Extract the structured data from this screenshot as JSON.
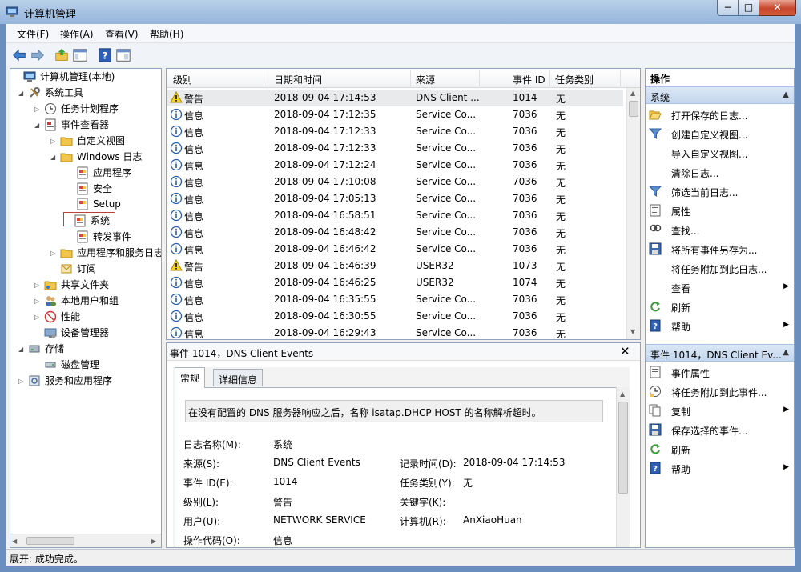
{
  "window": {
    "title": "计算机管理",
    "min": "−",
    "max": "□",
    "close": "✕"
  },
  "menu": [
    "文件(F)",
    "操作(A)",
    "查看(V)",
    "帮助(H)"
  ],
  "toolbar": [
    "back-arrow-icon",
    "forward-arrow-icon",
    "up-folder-icon",
    "show-hide-tree-icon",
    "help-icon",
    "properties-icon"
  ],
  "tree": [
    {
      "label": "计算机管理(本地)",
      "icon": "computer-icon",
      "expander": ""
    },
    {
      "label": "系统工具",
      "icon": "tools-icon",
      "expander": "◢"
    },
    {
      "label": "任务计划程序",
      "icon": "clock-icon",
      "expander": "▷"
    },
    {
      "label": "事件查看器",
      "icon": "event-viewer-icon",
      "expander": "◢"
    },
    {
      "label": "自定义视图",
      "icon": "folder-icon",
      "expander": "▷"
    },
    {
      "label": "Windows 日志",
      "icon": "folder-icon",
      "expander": "◢"
    },
    {
      "label": "应用程序",
      "icon": "log-icon",
      "expander": ""
    },
    {
      "label": "安全",
      "icon": "log-icon",
      "expander": ""
    },
    {
      "label": "Setup",
      "icon": "log-icon",
      "expander": ""
    },
    {
      "label": "系统",
      "icon": "log-icon",
      "expander": ""
    },
    {
      "label": "转发事件",
      "icon": "log-icon",
      "expander": ""
    },
    {
      "label": "应用程序和服务日志",
      "icon": "folder-icon",
      "expander": "▷"
    },
    {
      "label": "订阅",
      "icon": "subscription-icon",
      "expander": ""
    },
    {
      "label": "共享文件夹",
      "icon": "shared-folder-icon",
      "expander": "▷"
    },
    {
      "label": "本地用户和组",
      "icon": "users-icon",
      "expander": "▷"
    },
    {
      "label": "性能",
      "icon": "performance-icon",
      "expander": "▷"
    },
    {
      "label": "设备管理器",
      "icon": "device-manager-icon",
      "expander": ""
    },
    {
      "label": "存储",
      "icon": "storage-icon",
      "expander": "◢"
    },
    {
      "label": "磁盘管理",
      "icon": "disk-icon",
      "expander": ""
    },
    {
      "label": "服务和应用程序",
      "icon": "services-icon",
      "expander": "▷"
    }
  ],
  "events": {
    "columns": [
      "级别",
      "日期和时间",
      "来源",
      "事件 ID",
      "任务类别"
    ],
    "rows": [
      {
        "level": "警告",
        "type": "warning",
        "time": "2018-09-04 17:14:53",
        "source": "DNS Client ...",
        "id": "1014",
        "category": "无"
      },
      {
        "level": "信息",
        "type": "info",
        "time": "2018-09-04 17:12:35",
        "source": "Service Co...",
        "id": "7036",
        "category": "无"
      },
      {
        "level": "信息",
        "type": "info",
        "time": "2018-09-04 17:12:33",
        "source": "Service Co...",
        "id": "7036",
        "category": "无"
      },
      {
        "level": "信息",
        "type": "info",
        "time": "2018-09-04 17:12:33",
        "source": "Service Co...",
        "id": "7036",
        "category": "无"
      },
      {
        "level": "信息",
        "type": "info",
        "time": "2018-09-04 17:12:24",
        "source": "Service Co...",
        "id": "7036",
        "category": "无"
      },
      {
        "level": "信息",
        "type": "info",
        "time": "2018-09-04 17:10:08",
        "source": "Service Co...",
        "id": "7036",
        "category": "无"
      },
      {
        "level": "信息",
        "type": "info",
        "time": "2018-09-04 17:05:13",
        "source": "Service Co...",
        "id": "7036",
        "category": "无"
      },
      {
        "level": "信息",
        "type": "info",
        "time": "2018-09-04 16:58:51",
        "source": "Service Co...",
        "id": "7036",
        "category": "无"
      },
      {
        "level": "信息",
        "type": "info",
        "time": "2018-09-04 16:48:42",
        "source": "Service Co...",
        "id": "7036",
        "category": "无"
      },
      {
        "level": "信息",
        "type": "info",
        "time": "2018-09-04 16:46:42",
        "source": "Service Co...",
        "id": "7036",
        "category": "无"
      },
      {
        "level": "警告",
        "type": "warning",
        "time": "2018-09-04 16:46:39",
        "source": "USER32",
        "id": "1073",
        "category": "无"
      },
      {
        "level": "信息",
        "type": "info",
        "time": "2018-09-04 16:46:25",
        "source": "USER32",
        "id": "1074",
        "category": "无"
      },
      {
        "level": "信息",
        "type": "info",
        "time": "2018-09-04 16:35:55",
        "source": "Service Co...",
        "id": "7036",
        "category": "无"
      },
      {
        "level": "信息",
        "type": "info",
        "time": "2018-09-04 16:30:55",
        "source": "Service Co...",
        "id": "7036",
        "category": "无"
      },
      {
        "level": "信息",
        "type": "info",
        "time": "2018-09-04 16:29:43",
        "source": "Service Co...",
        "id": "7036",
        "category": "无"
      }
    ]
  },
  "detail": {
    "title": "事件 1014，DNS Client Events",
    "close": "✕",
    "tabs": [
      "常规",
      "详细信息"
    ],
    "description": "在没有配置的 DNS 服务器响应之后，名称 isatap.DHCP HOST 的名称解析超时。",
    "fields": {
      "log_name_label": "日志名称(M):",
      "log_name": "系统",
      "source_label": "来源(S):",
      "source": "DNS Client Events",
      "logged_label": "记录时间(D):",
      "logged": "2018-09-04 17:14:53",
      "event_id_label": "事件 ID(E):",
      "event_id": "1014",
      "task_label": "任务类别(Y):",
      "task": "无",
      "level_label": "级别(L):",
      "level": "警告",
      "keywords_label": "关键字(K):",
      "keywords": "",
      "user_label": "用户(U):",
      "user": "NETWORK SERVICE",
      "computer_label": "计算机(R):",
      "computer": "AnXiaoHuan",
      "opcode_label": "操作代码(O):",
      "opcode": "信息"
    }
  },
  "actions": {
    "header": "操作",
    "section1": "系统",
    "section1_items": [
      {
        "label": "打开保存的日志...",
        "icon": "open-folder-icon",
        "sub": ""
      },
      {
        "label": "创建自定义视图...",
        "icon": "filter-icon",
        "sub": ""
      },
      {
        "label": "导入自定义视图...",
        "icon": "",
        "sub": ""
      },
      {
        "label": "清除日志...",
        "icon": "",
        "sub": ""
      },
      {
        "label": "筛选当前日志...",
        "icon": "filter-icon",
        "sub": ""
      },
      {
        "label": "属性",
        "icon": "properties-icon",
        "sub": ""
      },
      {
        "label": "查找...",
        "icon": "find-icon",
        "sub": ""
      },
      {
        "label": "将所有事件另存为...",
        "icon": "save-icon",
        "sub": ""
      },
      {
        "label": "将任务附加到此日志...",
        "icon": "",
        "sub": ""
      },
      {
        "label": "查看",
        "icon": "",
        "sub": "▶"
      },
      {
        "label": "刷新",
        "icon": "refresh-icon",
        "sub": ""
      },
      {
        "label": "帮助",
        "icon": "help-icon",
        "sub": "▶"
      }
    ],
    "section2": "事件 1014，DNS Client Ev...",
    "section2_items": [
      {
        "label": "事件属性",
        "icon": "properties-icon",
        "sub": ""
      },
      {
        "label": "将任务附加到此事件...",
        "icon": "task-icon",
        "sub": ""
      },
      {
        "label": "复制",
        "icon": "copy-icon",
        "sub": "▶"
      },
      {
        "label": "保存选择的事件...",
        "icon": "save-icon",
        "sub": ""
      },
      {
        "label": "刷新",
        "icon": "refresh-icon",
        "sub": ""
      },
      {
        "label": "帮助",
        "icon": "help-icon",
        "sub": "▶"
      }
    ],
    "collapse": "▲"
  },
  "status": "展开: 成功完成。"
}
